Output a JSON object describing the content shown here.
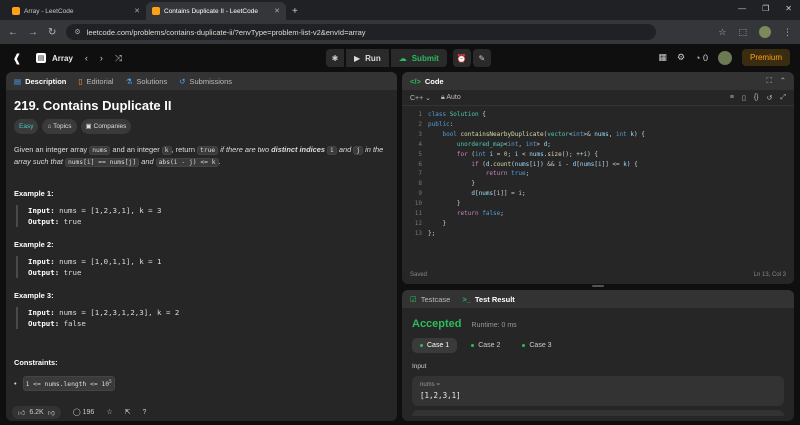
{
  "browser": {
    "tabs": [
      {
        "title": "Array - LeetCode",
        "active": false
      },
      {
        "title": "Contains Duplicate II - LeetCode",
        "active": true
      }
    ],
    "url": "leetcode.com/problems/contains-duplicate-ii/?envType=problem-list-v2&envId=array"
  },
  "topbar": {
    "list_title": "Array",
    "run_label": "Run",
    "submit_label": "Submit",
    "streak": "0",
    "premium_label": "Premium"
  },
  "left_tabs": [
    "Description",
    "Editorial",
    "Solutions",
    "Submissions"
  ],
  "problem": {
    "title": "219. Contains Duplicate II",
    "tags": [
      "Easy",
      "Topics",
      "Companies"
    ],
    "desc": {
      "t1": "Given an integer array ",
      "c1": "nums",
      "t2": " and an integer ",
      "c2": "k",
      "t3": ", return ",
      "c3": "true",
      "t4": " if there are two ",
      "b1": "distinct indices",
      "t5": " ",
      "c4": "i",
      "t6": " and ",
      "c5": "j",
      "t7": " in the array such that ",
      "c6": "nums[i] == nums[j]",
      "t8": " and ",
      "c7": "abs(i - j) <= k",
      "t9": "."
    },
    "examples": [
      {
        "title": "Example 1:",
        "input": "nums = [1,2,3,1], k = 3",
        "output": "true"
      },
      {
        "title": "Example 2:",
        "input": "nums = [1,0,1,1], k = 1",
        "output": "true"
      },
      {
        "title": "Example 3:",
        "input": "nums = [1,2,3,1,2,3], k = 2",
        "output": "false"
      }
    ],
    "input_label": "Input:",
    "output_label": "Output:",
    "constraints_title": "Constraints:",
    "constraint_1": "1 <= nums.length <= 10",
    "constraint_1_exp": "5",
    "likes": "6.2K",
    "comments": "196"
  },
  "code_panel": {
    "title": "Code",
    "language": "C++",
    "mode": "Auto",
    "status": "Saved",
    "cursor": "Ln 13, Col 3",
    "line_numbers": [
      "1",
      "2",
      "3",
      "4",
      "5",
      "6",
      "7",
      "8",
      "9",
      "10",
      "11",
      "12",
      "13"
    ]
  },
  "result_panel": {
    "tabs": [
      "Testcase",
      "Test Result"
    ],
    "verdict": "Accepted",
    "runtime": "Runtime: 0 ms",
    "cases": [
      "Case 1",
      "Case 2",
      "Case 3"
    ],
    "input_label": "Input",
    "var_name": "nums =",
    "var_value": "[1,2,3,1]"
  },
  "colors": {
    "accent": "#ffa116",
    "success": "#2cbb5d",
    "easy": "#46c6c2"
  }
}
